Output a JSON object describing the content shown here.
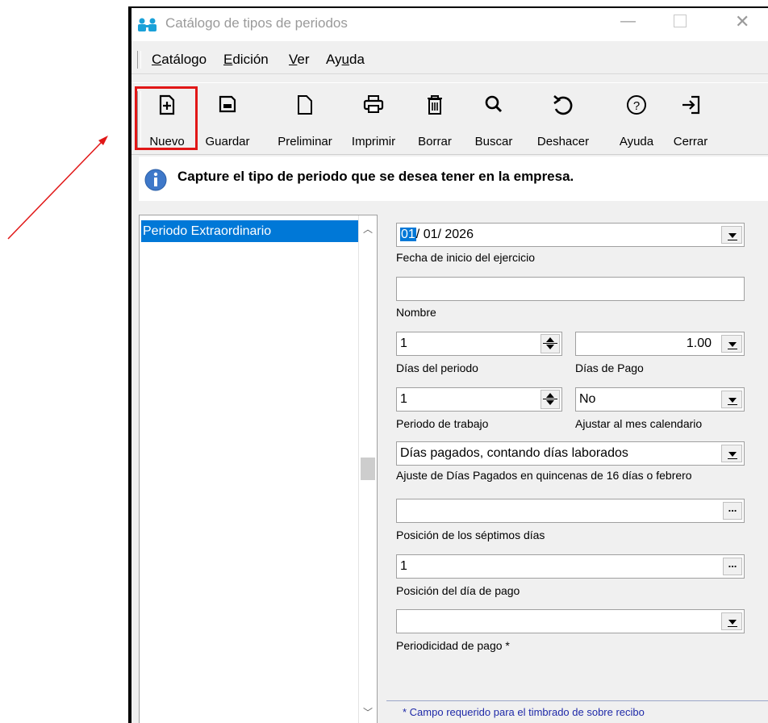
{
  "window": {
    "title": "Catálogo de tipos de periodos"
  },
  "menu": [
    {
      "label": "Catálogo",
      "accel": "C",
      "rest": "atálogo"
    },
    {
      "label": "Edición",
      "accel": "E",
      "rest": "dición"
    },
    {
      "label": "Ver",
      "accel": "V",
      "rest": "er"
    },
    {
      "label": "Ayuda",
      "pre": "Ay",
      "accel": "u",
      "rest": "da"
    }
  ],
  "toolbar": {
    "nuevo": "Nuevo",
    "guardar": "Guardar",
    "preliminar": "Preliminar",
    "imprimir": "Imprimir",
    "borrar": "Borrar",
    "buscar": "Buscar",
    "deshacer": "Deshacer",
    "ayuda": "Ayuda",
    "cerrar": "Cerrar"
  },
  "info": {
    "message": "Capture el tipo de periodo que se desea tener en la empresa."
  },
  "list": {
    "selected_item": "Periodo Extraordinario"
  },
  "form": {
    "fecha": {
      "day": "01",
      "rest": "/ 01/ 2026",
      "label": "Fecha de inicio del ejercicio"
    },
    "nombre": {
      "value": "",
      "label": "Nombre"
    },
    "dias_periodo": {
      "value": "1",
      "label": "Días del periodo"
    },
    "dias_pago": {
      "value": "1.00",
      "label": "Días de Pago"
    },
    "periodo_trabajo": {
      "value": "1",
      "label": "Periodo de trabajo"
    },
    "ajustar_mes": {
      "value": "No",
      "label": "Ajustar al mes calendario"
    },
    "ajuste_dias": {
      "value": "Días pagados, contando días laborados",
      "label": "Ajuste de Días Pagados en quincenas de 16 días o febrero"
    },
    "posicion_septimos": {
      "value": "",
      "label": "Posición de los séptimos días"
    },
    "posicion_dia_pago": {
      "value": "1",
      "label": "Posición del día de pago"
    },
    "periodicidad": {
      "value": "",
      "label": "Periodicidad de pago *"
    }
  },
  "footer": {
    "note": "* Campo requerido para el timbrado de sobre recibo"
  },
  "colors": {
    "selection": "#0078d7",
    "highlight_box": "#e11717",
    "annotation_arrow": "#e11717",
    "footer_text": "#1f2aa8"
  }
}
